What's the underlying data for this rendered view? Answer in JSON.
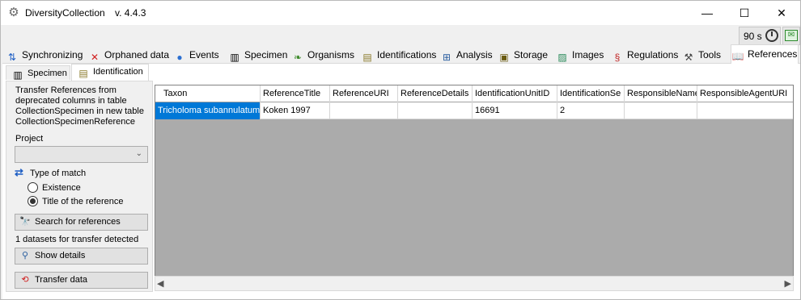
{
  "window": {
    "title": "DiversityCollection",
    "version": "v. 4.4.3",
    "icon": "gear-icon",
    "controls": [
      "minimize",
      "maximize",
      "close"
    ]
  },
  "toolbar": {
    "timer_label": "90 s",
    "timer_icon": "clock-icon",
    "mail_icon": "mail-send-icon"
  },
  "main_tabs": [
    {
      "label": "Synchronizing",
      "icon": "sync-icon",
      "glyph": "⇅",
      "color": "#1f5fc4"
    },
    {
      "label": "Orphaned data",
      "icon": "red-x-icon",
      "glyph": "✕",
      "color": "#d02020"
    },
    {
      "label": "Events",
      "icon": "globe-icon",
      "glyph": "●",
      "color": "#2b6fd1"
    },
    {
      "label": "Specimen",
      "icon": "barcode-icon",
      "glyph": "▥",
      "color": "#000000"
    },
    {
      "label": "Organisms",
      "icon": "leaf-icon",
      "glyph": "❧",
      "color": "#3d8a2a"
    },
    {
      "label": "Identifications",
      "icon": "identification-list-icon",
      "glyph": "▤",
      "color": "#8a7a2a"
    },
    {
      "label": "Analysis",
      "icon": "analysis-icon",
      "glyph": "⊞",
      "color": "#2b5fa0"
    },
    {
      "label": "Storage",
      "icon": "storage-icon",
      "glyph": "▣",
      "color": "#6a5a10"
    },
    {
      "label": "Images",
      "icon": "image-icon",
      "glyph": "▨",
      "color": "#2a8a5a"
    },
    {
      "label": "Regulations",
      "icon": "paragraph-icon",
      "glyph": "§",
      "color": "#c02020"
    },
    {
      "label": "Tools",
      "icon": "tools-icon",
      "glyph": "⚒",
      "color": "#444444"
    },
    {
      "label": "References",
      "icon": "book-icon",
      "glyph": "📖",
      "color": "#333333"
    }
  ],
  "active_main_tab": "References",
  "sub_tabs": [
    {
      "label": "Specimen",
      "icon": "barcode-icon",
      "glyph": "▥"
    },
    {
      "label": "Identification",
      "icon": "identification-list-icon",
      "glyph": "▤"
    }
  ],
  "active_sub_tab": "Identification",
  "left_panel": {
    "description": "Transfer References from deprecated columns in table CollectionSpecimen in new table CollectionSpecimenReference",
    "project_label": "Project",
    "project_value": "",
    "type_of_match_label": "Type of match",
    "options": [
      {
        "label": "Existence",
        "checked": false
      },
      {
        "label": "Title of the reference",
        "checked": true
      }
    ],
    "search_button": "Search for references",
    "status": "1 datasets for transfer detected",
    "show_details_button": "Show details",
    "transfer_button": "Transfer data"
  },
  "grid": {
    "columns": [
      "Taxon",
      "ReferenceTitle",
      "ReferenceURI",
      "ReferenceDetails",
      "IdentificationUnitID",
      "IdentificationSe",
      "ResponsibleName",
      "ResponsibleAgentURI"
    ],
    "rows": [
      [
        "Tricholoma subannulatum",
        "Koken 1997",
        "",
        "",
        "16691",
        "2",
        "",
        ""
      ]
    ],
    "selected_cell": [
      0,
      0
    ]
  }
}
